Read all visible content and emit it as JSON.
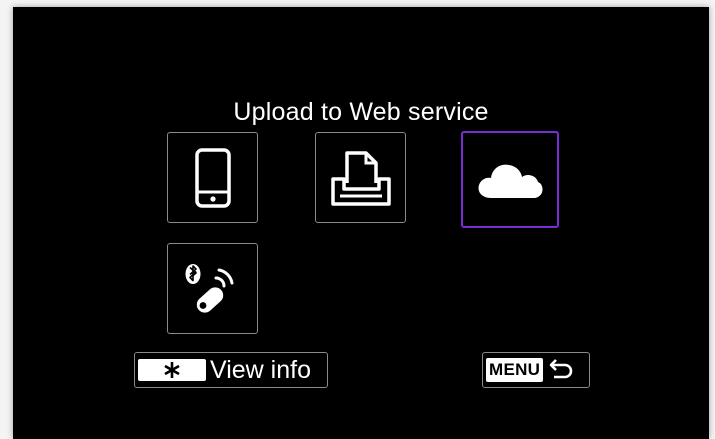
{
  "screen": {
    "title": "Upload to Web service"
  },
  "tiles": [
    {
      "name": "smartphone",
      "icon": "smartphone-icon",
      "selected": false
    },
    {
      "name": "printer",
      "icon": "printer-icon",
      "selected": false
    },
    {
      "name": "web-service",
      "icon": "cloud-icon",
      "selected": true
    },
    {
      "name": "bluetooth-remote",
      "icon": "bluetooth-remote-icon",
      "selected": false
    }
  ],
  "footer": {
    "info_key_icon": "asterisk-icon",
    "info_label": "View info",
    "menu_key_label": "MENU",
    "back_icon": "return-arrow-icon"
  },
  "colors": {
    "background": "#000000",
    "selection": "#7a2dd6",
    "border": "#8a8a8a",
    "foreground": "#ffffff"
  }
}
